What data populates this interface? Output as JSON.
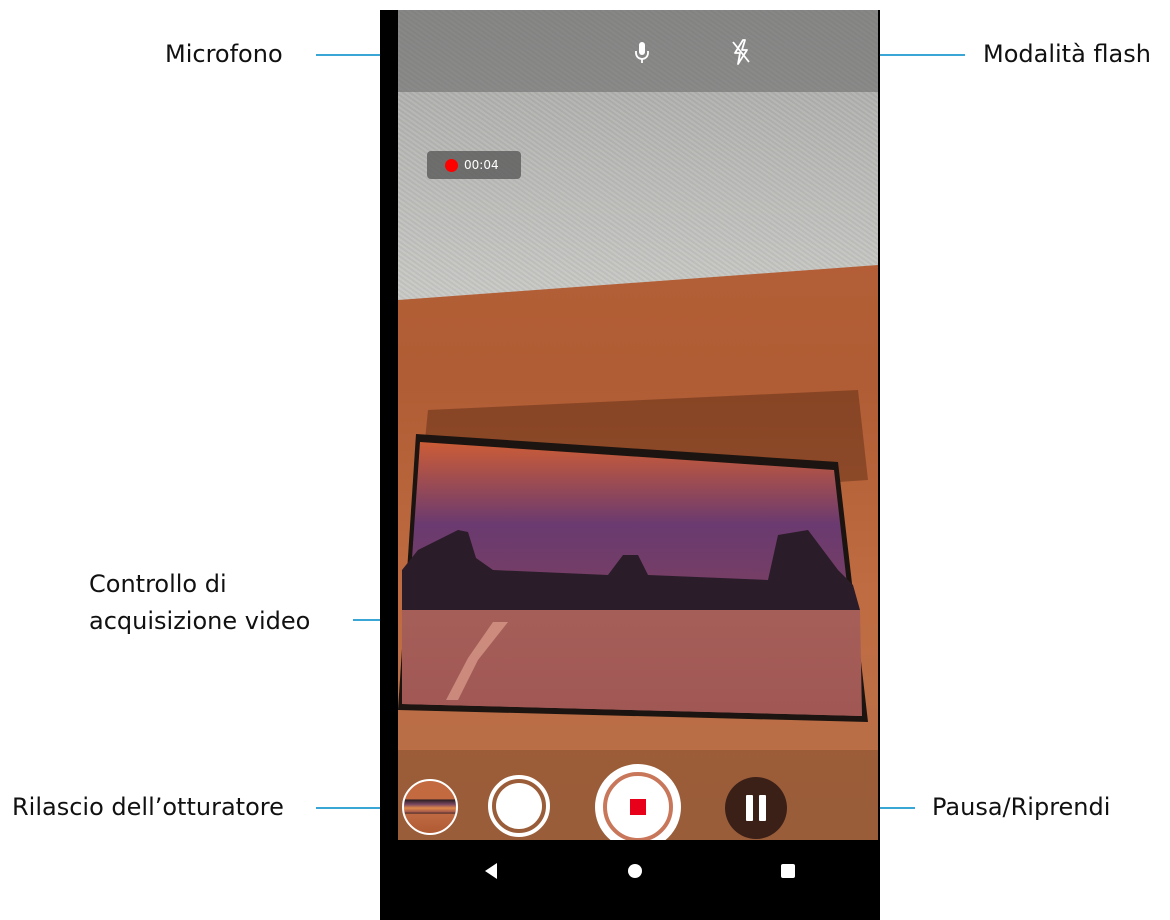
{
  "callouts": {
    "microphone": "Microfono",
    "flash_mode": "Modalità flash",
    "video_capture_line1": "Controllo di",
    "video_capture_line2": "acquisizione video",
    "shutter_release": "Rilascio dell’otturatore",
    "pause_resume": "Pausa/Riprendi"
  },
  "recording": {
    "elapsed": "00:04",
    "indicator_color": "#ff0000"
  },
  "top_bar": {
    "icons": [
      "microphone-icon",
      "flash-off-icon"
    ]
  },
  "bottom_bar": {
    "controls": [
      "gallery-thumbnail",
      "photo-shutter-button",
      "video-stop-button",
      "pause-button"
    ]
  },
  "navbar": {
    "icons": [
      "back-icon",
      "home-icon",
      "recents-icon"
    ]
  },
  "colors": {
    "leader_line": "#3aa6d6",
    "stop_square": "#e8001b",
    "pause_button_bg": "#3b2018"
  }
}
